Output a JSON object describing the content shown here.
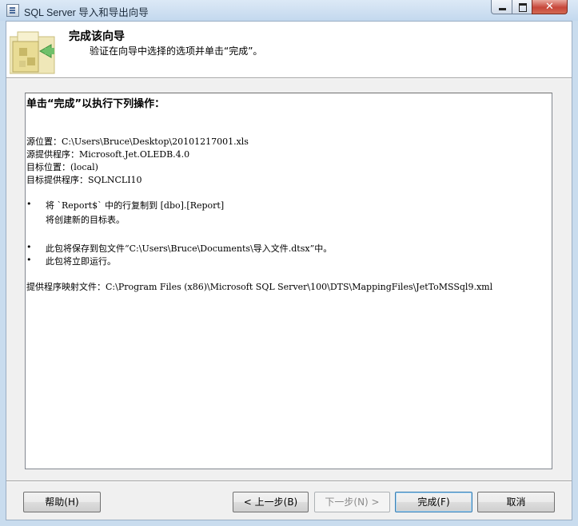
{
  "window": {
    "title": "SQL Server 导入和导出向导",
    "close_glyph": "✕"
  },
  "header": {
    "title": "完成该向导",
    "subtitle": "验证在向导中选择的选项并单击“完成”。"
  },
  "summary": {
    "heading": "单击“完成”以执行下列操作：",
    "source_location": "源位置：C:\\Users\\Bruce\\Desktop\\20101217001.xls",
    "source_provider": "源提供程序：Microsoft.Jet.OLEDB.4.0",
    "dest_location": "目标位置：(local)",
    "dest_provider": "目标提供程序：SQLNCLI10",
    "bullet_glyph": "•",
    "copy_rows": "将 `Report$` 中的行复制到 [dbo].[Report]",
    "create_table": "将创建新的目标表。",
    "save_package": "此包将保存到包文件“C:\\Users\\Bruce\\Documents\\导入文件.dtsx”中。",
    "run_now": "此包将立即运行。",
    "mapping_file": "提供程序映射文件：C:\\Program Files (x86)\\Microsoft SQL Server\\100\\DTS\\MappingFiles\\JetToMSSql9.xml"
  },
  "buttons": {
    "help": "帮助(H)",
    "back": "< 上一步(B)",
    "next": "下一步(N) >",
    "finish": "完成(F)",
    "cancel": "取消"
  }
}
